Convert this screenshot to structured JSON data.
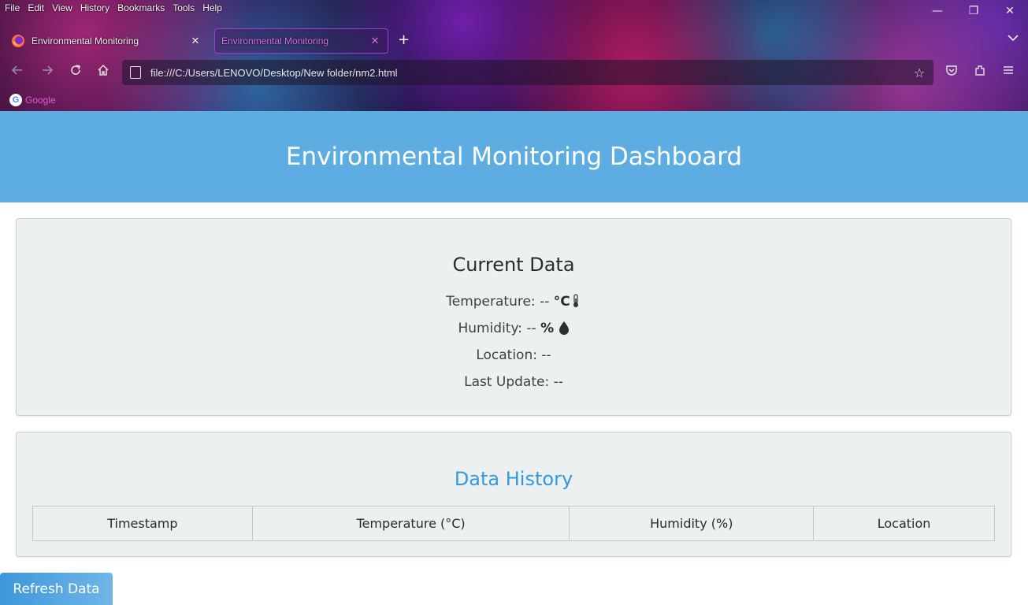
{
  "browser": {
    "menu": [
      "File",
      "Edit",
      "View",
      "History",
      "Bookmarks",
      "Tools",
      "Help"
    ],
    "window_controls": {
      "minimize": "—",
      "restore": "❐",
      "close": "✕"
    },
    "tabs": [
      {
        "title": "Environmental Monitoring",
        "active": false
      },
      {
        "title": "Environmental Monitoring",
        "active": true
      }
    ],
    "new_tab": "+",
    "tab_list_icon": "chevron-down-icon",
    "url": "file:///C:/Users/LENOVO/Desktop/New folder/nm2.html",
    "bookmarks": [
      {
        "label": "Google",
        "icon": "google-icon"
      }
    ],
    "accent": "#d66fe0"
  },
  "page": {
    "header": {
      "title": "Environmental Monitoring Dashboard",
      "bg": "#5dade2"
    },
    "current": {
      "heading": "Current Data",
      "temperature": {
        "label": "Temperature:",
        "value": "--",
        "unit": "°C",
        "icon": "thermometer-icon"
      },
      "humidity": {
        "label": "Humidity:",
        "value": "--",
        "unit": "%",
        "icon": "water-drop-icon"
      },
      "location": {
        "label": "Location:",
        "value": "--"
      },
      "last_update": {
        "label": "Last Update:",
        "value": "--"
      }
    },
    "history": {
      "heading": "Data History",
      "heading_color": "#3498db",
      "columns": [
        "Timestamp",
        "Temperature (°C)",
        "Humidity (%)",
        "Location"
      ],
      "rows": []
    },
    "refresh_label": "Refresh Data"
  }
}
